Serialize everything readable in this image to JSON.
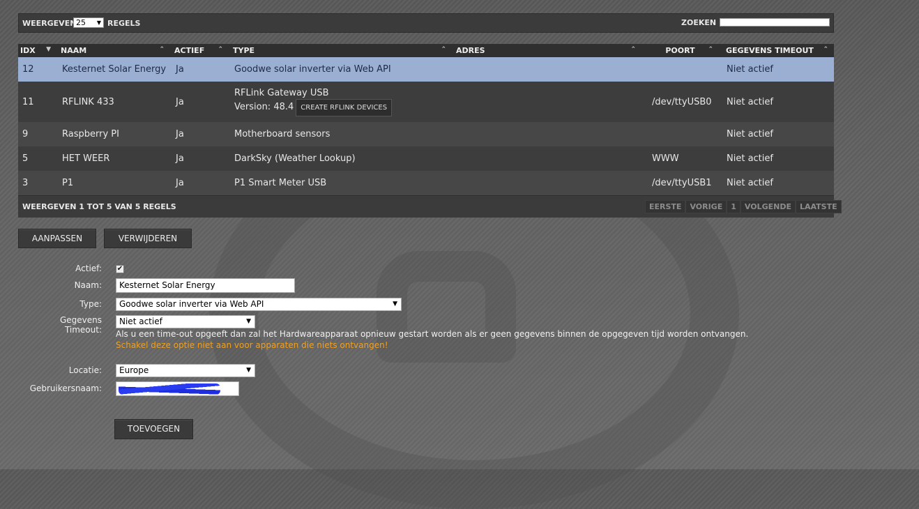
{
  "top": {
    "show_label": "WEERGEVEN",
    "page_size": "25",
    "rules_label": "REGELS",
    "search_label": "ZOEKEN :",
    "search_value": ""
  },
  "table": {
    "headers": [
      "IDX",
      "NAAM",
      "ACTIEF",
      "TYPE",
      "ADRES",
      "POORT",
      "GEGEVENS TIMEOUT"
    ],
    "rows": [
      {
        "idx": "12",
        "name": "Kesternet Solar Energy",
        "active": "Ja",
        "type": "Goodwe solar inverter via Web API",
        "address": "",
        "port": "",
        "timeout": "Niet actief"
      },
      {
        "idx": "11",
        "name": "RFLINK 433",
        "active": "Ja",
        "type": "RFLink Gateway USB",
        "version": "Version: 48.4",
        "button": "CREATE RFLINK DEVICES",
        "address": "",
        "port": "/dev/ttyUSB0",
        "timeout": "Niet actief"
      },
      {
        "idx": "9",
        "name": "Raspberry PI",
        "active": "Ja",
        "type": "Motherboard sensors",
        "address": "",
        "port": "",
        "timeout": "Niet actief"
      },
      {
        "idx": "5",
        "name": "HET WEER",
        "active": "Ja",
        "type": "DarkSky (Weather Lookup)",
        "address": "",
        "port": "WWW",
        "timeout": "Niet actief"
      },
      {
        "idx": "3",
        "name": "P1",
        "active": "Ja",
        "type": "P1 Smart Meter USB",
        "address": "",
        "port": "/dev/ttyUSB1",
        "timeout": "Niet actief"
      }
    ],
    "info": "WEERGEVEN 1 TOT 5 VAN 5 REGELS",
    "pager": [
      "EERSTE",
      "VORIGE",
      "1",
      "VOLGENDE",
      "LAATSTE"
    ]
  },
  "buttons": {
    "edit": "AANPASSEN",
    "delete": "VERWIJDEREN",
    "add": "TOEVOEGEN"
  },
  "form": {
    "active_label": "Actief:",
    "active_checked": true,
    "name_label": "Naam:",
    "name_value": "Kesternet Solar Energy",
    "type_label": "Type:",
    "type_value": "Goodwe solar inverter via Web API",
    "timeout_label_1": "Gegevens",
    "timeout_label_2": "Timeout:",
    "timeout_value": "Niet actief",
    "timeout_help": "Als u een time-out opgeeft dan zal het Hardwareapparaat opnieuw gestart worden als er geen gegevens binnen de opgegeven tijd worden ontvangen.",
    "timeout_warning": "Schakel deze optie niet aan voor apparaten die niets ontvangen!",
    "location_label": "Locatie:",
    "location_value": "Europe",
    "username_label": "Gebruikersnaam:"
  }
}
